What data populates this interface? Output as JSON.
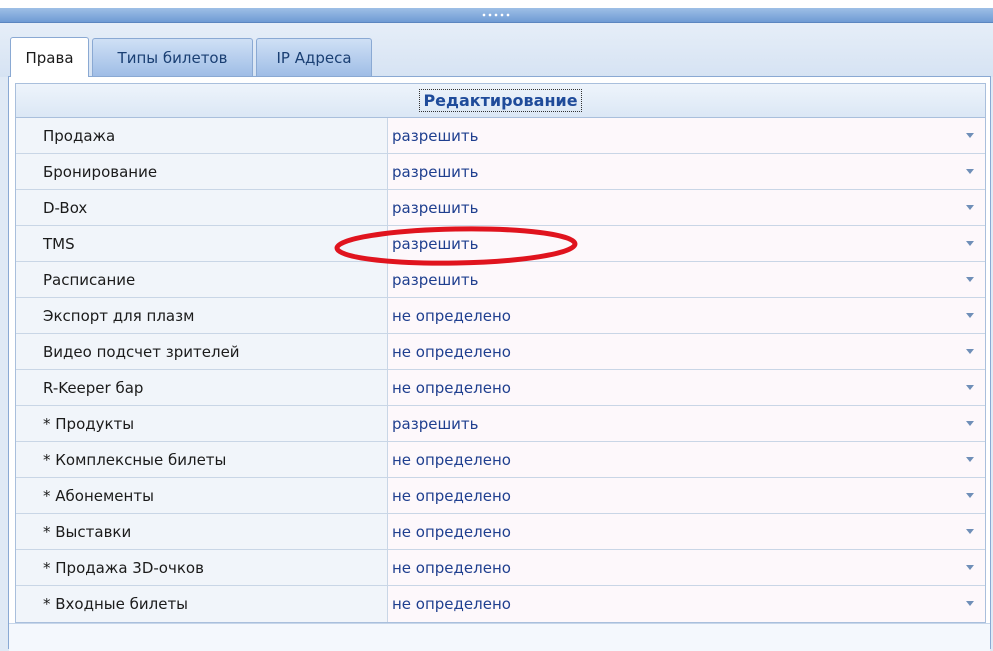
{
  "tabs": [
    {
      "label": "Права"
    },
    {
      "label": "Типы билетов"
    },
    {
      "label": "IP Адреса"
    }
  ],
  "grid": {
    "header": "Редактирование",
    "rows": [
      {
        "name": "Продажа",
        "value": "разрешить"
      },
      {
        "name": "Бронирование",
        "value": "разрешить"
      },
      {
        "name": "D-Box",
        "value": "разрешить"
      },
      {
        "name": "TMS",
        "value": "разрешить"
      },
      {
        "name": "Расписание",
        "value": "разрешить"
      },
      {
        "name": "Экспорт для плазм",
        "value": "не определено"
      },
      {
        "name": "Видео подсчет зрителей",
        "value": "не определено"
      },
      {
        "name": "R-Keeper бар",
        "value": "не определено"
      },
      {
        "name": "* Продукты",
        "value": "разрешить"
      },
      {
        "name": "* Комплексные билеты",
        "value": "не определено"
      },
      {
        "name": "* Абонементы",
        "value": "не определено"
      },
      {
        "name": "* Выставки",
        "value": "не определено"
      },
      {
        "name": "* Продажа 3D-очков",
        "value": "не определено"
      },
      {
        "name": "* Входные билеты",
        "value": "не определено"
      }
    ]
  },
  "colors": {
    "annotation": "#e0141e",
    "value_text": "#1f3f8f",
    "header_text": "#1f4b9a"
  }
}
